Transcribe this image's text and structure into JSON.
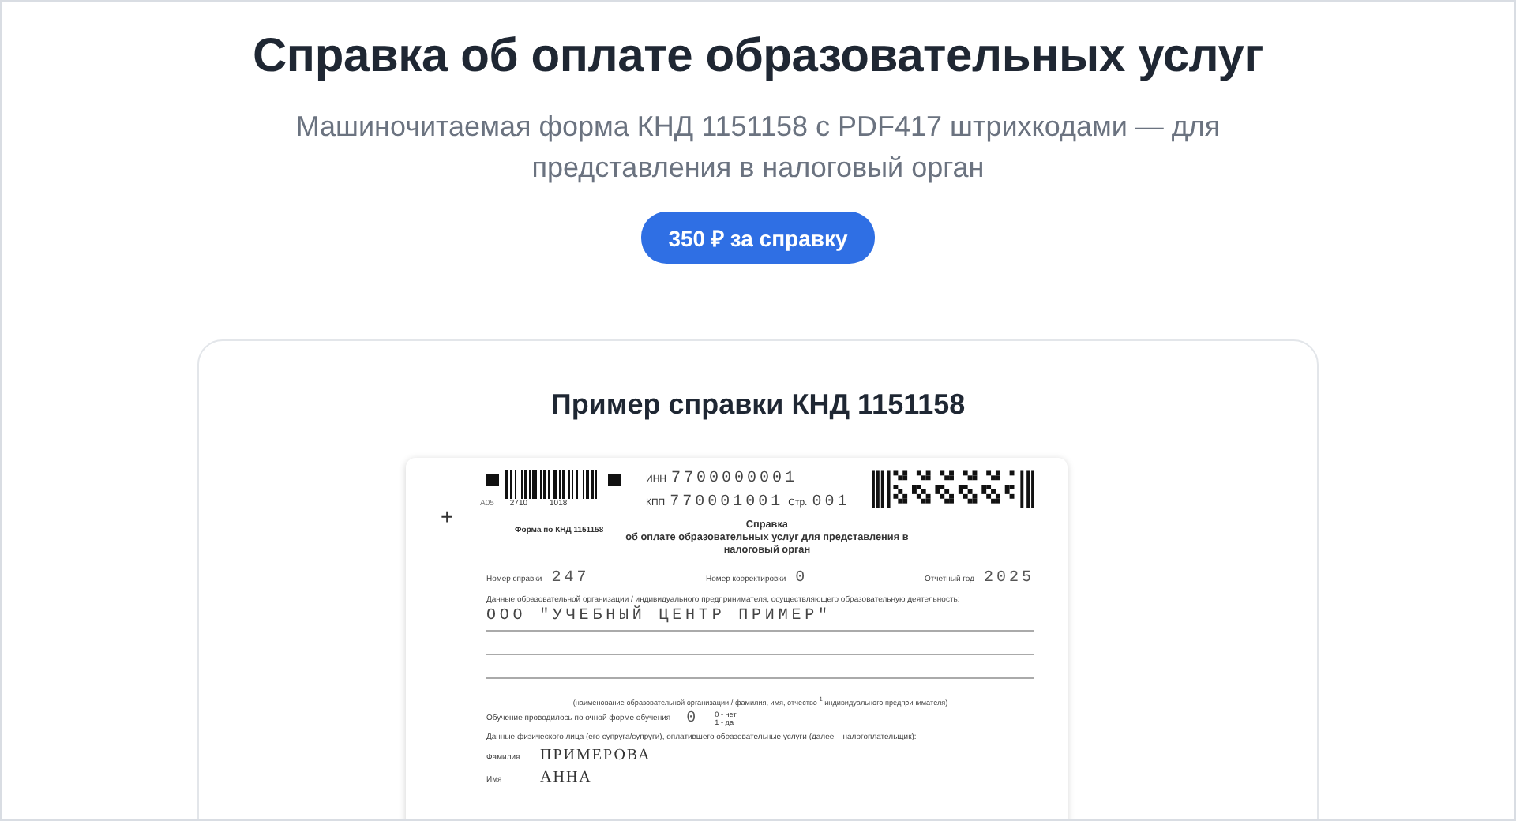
{
  "header": {
    "title": "Справка об оплате образовательных услуг",
    "subtitle": "Машиночитаемая форма КНД 1151158 с PDF417 штрихкодами — для представления в налоговый орган",
    "price_button": "350 ₽ за справку"
  },
  "sample": {
    "title": "Пример справки КНД 1151158",
    "document": {
      "barcode_code": "A05",
      "barcode_numbers": [
        "2710",
        "1018"
      ],
      "inn_label": "ИНН",
      "inn": "7700000001",
      "kpp_label": "КПП",
      "kpp": "770001001",
      "page_label": "Стр.",
      "page": "001",
      "cross": "+",
      "form_label": "Форма по КНД 1151158",
      "title_lines": [
        "Справка",
        "об оплате образовательных услуг для представления в",
        "налоговый орган"
      ],
      "number_label": "Номер справки",
      "number": "247",
      "correction_label": "Номер корректировки",
      "correction": "0",
      "year_label": "Отчетный год",
      "year": "2025",
      "org_label": "Данные образовательной организации / индивидуального предпринимателя, осуществляющего образовательную деятельность:",
      "org_value": "ООО \"УЧЕБНЫЙ ЦЕНТР ПРИМЕР\"",
      "org_caption": "(наименование образовательной организации / фамилия, имя, отчество $^{1}$  индивидуального предпринимателя)",
      "full_time_label": "Обучение проводилось по очной форме обучения",
      "full_time": "0",
      "full_time_options": [
        "0 - нет",
        "1 - да"
      ],
      "payer_label": "Данные физического лица (его супруга/супруги), оплатившего образовательные услуги (далее – налогоплательщик):",
      "payer_fields": [
        {
          "label": "Фамилия",
          "value": "ПРИМЕРОВА"
        },
        {
          "label": "Имя",
          "value": "АННА"
        }
      ]
    }
  }
}
